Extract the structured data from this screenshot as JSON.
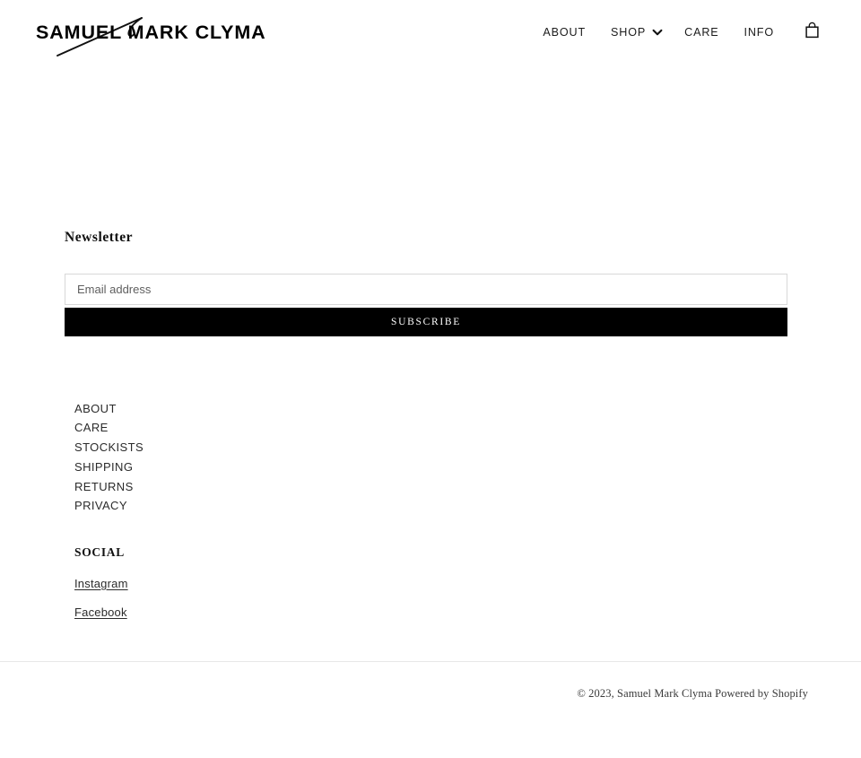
{
  "header": {
    "logo_text": "SAMUEL MARK CLYMA",
    "logo_icon": "signature-swash",
    "nav": [
      {
        "label": "ABOUT",
        "icon": null
      },
      {
        "label": "SHOP",
        "icon": "chevron-down-icon"
      },
      {
        "label": "CARE",
        "icon": null
      },
      {
        "label": "INFO",
        "icon": null
      }
    ],
    "cart_icon": "shopping-bag-icon"
  },
  "footer": {
    "newsletter": {
      "title": "Newsletter",
      "email_placeholder": "Email address",
      "email_value": "",
      "subscribe_label": "SUBSCRIBE"
    },
    "links": [
      {
        "label": "ABOUT"
      },
      {
        "label": "CARE"
      },
      {
        "label": "STOCKISTS"
      },
      {
        "label": "SHIPPING"
      },
      {
        "label": "RETURNS"
      },
      {
        "label": "PRIVACY"
      }
    ],
    "social": {
      "title": "SOCIAL",
      "links": [
        {
          "label": "Instagram"
        },
        {
          "label": "Facebook"
        }
      ]
    },
    "copyright": {
      "text": "© 2023, Samuel Mark Clyma",
      "powered_by": "Powered by Shopify"
    }
  },
  "colors": {
    "background": "#ffffff",
    "text": "#1c1c1c",
    "button_bg": "#000000",
    "button_text": "#ffffff",
    "input_border": "#d8d8d8",
    "divider": "#e7e7e7"
  }
}
